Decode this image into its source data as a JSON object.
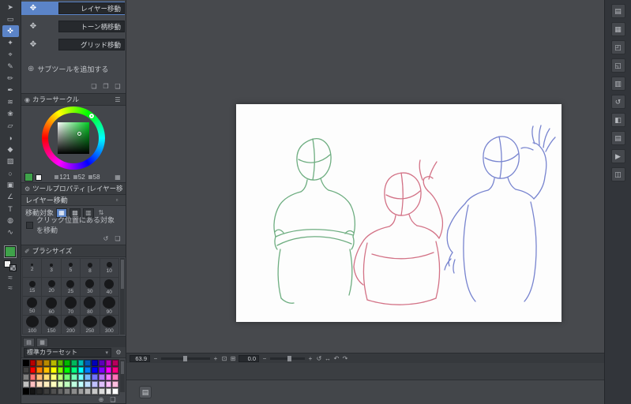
{
  "toolbar": {
    "tools": [
      {
        "name": "operation-tool-icon",
        "glyph": "➤",
        "selected": false
      },
      {
        "name": "selection-tool-icon",
        "glyph": "▭",
        "selected": false
      },
      {
        "name": "layer-move-tool-icon",
        "glyph": "✜",
        "selected": true
      },
      {
        "name": "auto-select-tool-icon",
        "glyph": "✦",
        "selected": false
      },
      {
        "name": "eyedropper-tool-icon",
        "glyph": "⌖",
        "selected": false
      },
      {
        "name": "pen-tool-icon",
        "glyph": "✎",
        "selected": false
      },
      {
        "name": "pencil-tool-icon",
        "glyph": "✏",
        "selected": false
      },
      {
        "name": "brush-tool-icon",
        "glyph": "✒",
        "selected": false
      },
      {
        "name": "airbrush-tool-icon",
        "glyph": "≋",
        "selected": false
      },
      {
        "name": "decoration-tool-icon",
        "glyph": "❀",
        "selected": false
      },
      {
        "name": "eraser-tool-icon",
        "glyph": "▱",
        "selected": false
      },
      {
        "name": "blend-tool-icon",
        "glyph": "◑",
        "selected": false
      },
      {
        "name": "fill-tool-icon",
        "glyph": "◆",
        "selected": false
      },
      {
        "name": "gradient-tool-icon",
        "glyph": "▨",
        "selected": false
      },
      {
        "name": "figure-tool-icon",
        "glyph": "○",
        "selected": false
      },
      {
        "name": "frame-border-tool-icon",
        "glyph": "▣",
        "selected": false
      },
      {
        "name": "ruler-tool-icon",
        "glyph": "∠",
        "selected": false
      },
      {
        "name": "text-tool-icon",
        "glyph": "T",
        "selected": false
      },
      {
        "name": "balloon-tool-icon",
        "glyph": "◍",
        "selected": false
      },
      {
        "name": "line-correction-tool-icon",
        "glyph": "∿",
        "selected": false
      }
    ],
    "main_color": "#3fa24a",
    "sub_color": "#f2f2f2"
  },
  "subtool_panel": {
    "items": [
      {
        "glyph": "✥",
        "label": "レイヤー移動",
        "selected": true
      },
      {
        "glyph": "✥",
        "label": "トーン柄移動",
        "selected": false
      },
      {
        "glyph": "✥",
        "label": "グリッド移動",
        "selected": false
      }
    ],
    "add_button": "サブツールを追加する"
  },
  "color_panel": {
    "title": "カラーサークル",
    "values": [
      "121",
      "52",
      "58"
    ]
  },
  "tool_property": {
    "title": "ツールプロパティ [レイヤー移動]",
    "tool_name": "レイヤー移動",
    "move_target_label": "移動対象",
    "checkbox_label": "クリック位置にある対象を移動",
    "checkbox_checked": false
  },
  "brush_panel": {
    "title": "ブラシサイズ",
    "sizes": [
      {
        "label": "2",
        "dot": "3px"
      },
      {
        "label": "3",
        "dot": "4px"
      },
      {
        "label": "5",
        "dot": "5px"
      },
      {
        "label": "8",
        "dot": "6px"
      },
      {
        "label": "10",
        "dot": "7px"
      },
      {
        "label": "15",
        "dot": "8px"
      },
      {
        "label": "20",
        "dot": "9px"
      },
      {
        "label": "25",
        "dot": "10px"
      },
      {
        "label": "30",
        "dot": "11px"
      },
      {
        "label": "40",
        "dot": "12px"
      },
      {
        "label": "50",
        "dot": "13px"
      },
      {
        "label": "60",
        "dot": "14px"
      },
      {
        "label": "70",
        "dot": "15px"
      },
      {
        "label": "80",
        "dot": "15px"
      },
      {
        "label": "90",
        "dot": "16px"
      },
      {
        "label": "100",
        "dot": "16px"
      },
      {
        "label": "150",
        "dot": "17px"
      },
      {
        "label": "200",
        "dot": "17px"
      },
      {
        "label": "250",
        "dot": "18px"
      },
      {
        "label": "300",
        "dot": "18px"
      }
    ]
  },
  "color_set_panel": {
    "title": "標準カラーセット",
    "swatches": [
      "#000000",
      "#b80000",
      "#b85c00",
      "#b88a00",
      "#b8b800",
      "#5cb800",
      "#00b800",
      "#00b85c",
      "#00b8b8",
      "#005cb8",
      "#0000b8",
      "#5c00b8",
      "#b800b8",
      "#b8005c",
      "#404040",
      "#ff0000",
      "#ff8000",
      "#ffbf00",
      "#ffff00",
      "#80ff00",
      "#00ff00",
      "#00ff80",
      "#00ffff",
      "#0080ff",
      "#0000ff",
      "#8000ff",
      "#ff00ff",
      "#ff0080",
      "#808080",
      "#ff7373",
      "#ffb973",
      "#ffdc73",
      "#ffff73",
      "#b9ff73",
      "#73ff73",
      "#73ffb9",
      "#73ffff",
      "#73b9ff",
      "#7373ff",
      "#b973ff",
      "#ff73ff",
      "#ff73b9",
      "#c0c0c0",
      "#ffbfbf",
      "#ffdfbf",
      "#ffefbf",
      "#ffffbf",
      "#dfffbf",
      "#bfffbf",
      "#bfffdf",
      "#bfffff",
      "#bfdfff",
      "#bfbfff",
      "#dfbfff",
      "#ffbfff",
      "#ffbfdf",
      "#000000",
      "#141414",
      "#282828",
      "#3c3c3c",
      "#505050",
      "#646464",
      "#787878",
      "#8c8c8c",
      "#a0a0a0",
      "#b4b4b4",
      "#c8c8c8",
      "#dcdcdc",
      "#f0f0f0",
      "#ffffff"
    ]
  },
  "canvas": {
    "zoom": "63.9",
    "rotation": "0.0",
    "figures": [
      {
        "name": "green-figure",
        "color": "#55a06b"
      },
      {
        "name": "red-figure",
        "color": "#cc5a72"
      },
      {
        "name": "blue-figure",
        "color": "#6170c8"
      }
    ]
  },
  "right_dock": {
    "panels": [
      {
        "name": "quick-access-panel-icon",
        "glyph": "▤"
      },
      {
        "name": "material-panel-icon",
        "glyph": "▦"
      },
      {
        "name": "navigator-panel-icon",
        "glyph": "◰"
      },
      {
        "name": "sub-view-panel-icon",
        "glyph": "◱"
      },
      {
        "name": "information-panel-icon",
        "glyph": "▥"
      },
      {
        "name": "history-panel-icon",
        "glyph": "↺"
      },
      {
        "name": "layer-property-panel-icon",
        "glyph": "◧"
      },
      {
        "name": "layer-panel-icon",
        "glyph": "▤"
      },
      {
        "name": "auto-action-panel-icon",
        "glyph": "▶"
      },
      {
        "name": "timeline-panel-icon",
        "glyph": "◫"
      }
    ]
  }
}
